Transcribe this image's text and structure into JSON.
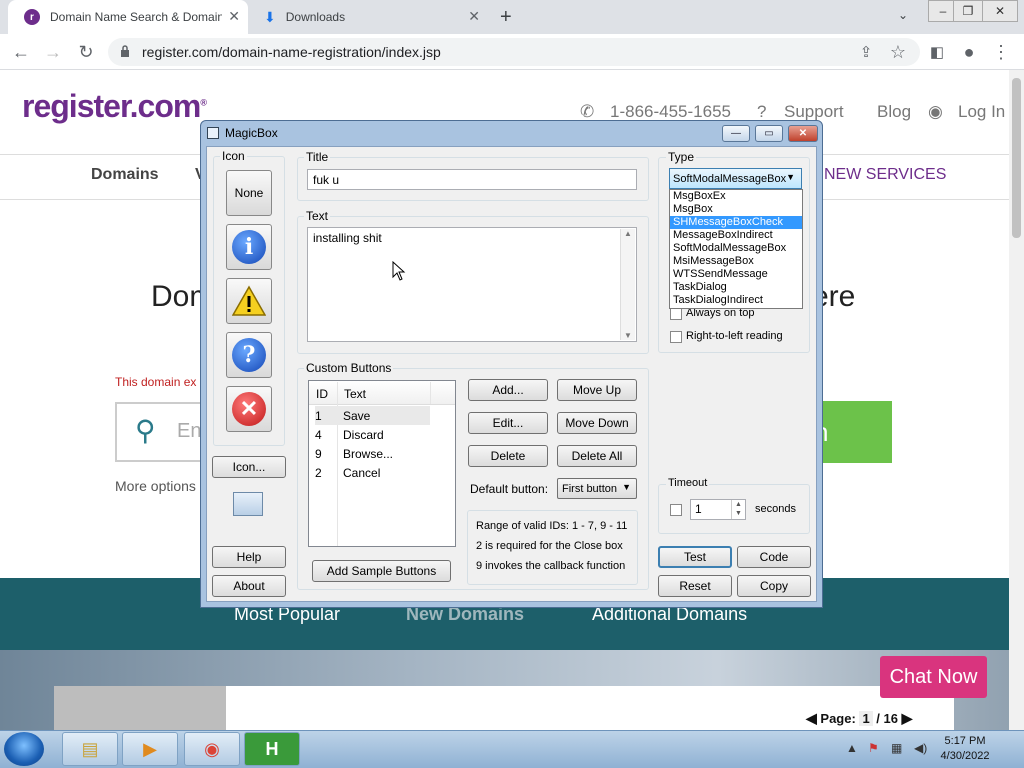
{
  "browser": {
    "tabs": [
      {
        "title": "Domain Name Search & Domain",
        "active": true
      },
      {
        "title": "Downloads",
        "active": false
      }
    ],
    "new_tab": "+",
    "url": "register.com/domain-name-registration/index.jsp"
  },
  "site": {
    "logo": "register.com",
    "logo_mark": "®",
    "phone": "1-866-455-1655",
    "support": "Support",
    "blog": "Blog",
    "login": "Log In",
    "nav": [
      "Domains",
      "V",
      "NEW SERVICES"
    ],
    "headline_left": "Dom",
    "headline_right": "ere",
    "domain_exists_text": "This domain ex",
    "search_placeholder": "Ent",
    "search_button": "h",
    "more_options": "More options",
    "teal_tabs": [
      "Most Popular",
      "New Domains",
      "Additional Domains"
    ],
    "chat_now": "Chat Now",
    "pager": {
      "label": "Page:",
      "current": "1",
      "total": "/ 16"
    }
  },
  "taskbar": {
    "time": "5:17 PM",
    "date": "4/30/2022"
  },
  "magicbox": {
    "title": "MagicBox",
    "icon_label": "Icon",
    "icon_none": "None",
    "icon_button": "Icon...",
    "help": "Help",
    "about": "About",
    "title_label": "Title",
    "title_value": "fuk u",
    "text_label": "Text",
    "text_value": "installing shit",
    "type_label": "Type",
    "type_selected": "SoftModalMessageBox",
    "type_options": [
      "MsgBoxEx",
      "MsgBox",
      "SHMessageBoxCheck",
      "MessageBoxIndirect",
      "SoftModalMessageBox",
      "MsiMessageBox",
      "WTSSendMessage",
      "TaskDialog",
      "TaskDialogIndirect"
    ],
    "type_highlight_index": 2,
    "always_on_top": "Always on top",
    "rtl": "Right-to-left reading",
    "custom_buttons_label": "Custom Buttons",
    "lv_headers": [
      "ID",
      "Text"
    ],
    "lv_rows": [
      {
        "id": "1",
        "text": "Save"
      },
      {
        "id": "4",
        "text": "Discard"
      },
      {
        "id": "9",
        "text": "Browse..."
      },
      {
        "id": "2",
        "text": "Cancel"
      }
    ],
    "add": "Add...",
    "move_up": "Move Up",
    "edit": "Edit...",
    "move_down": "Move Down",
    "delete": "Delete",
    "delete_all": "Delete All",
    "default_button_label": "Default button:",
    "default_button_value": "First button",
    "info_lines": [
      "Range of valid IDs: 1 - 7, 9 - 11",
      "2  is required for the Close box",
      "9  invokes the callback function"
    ],
    "add_sample": "Add Sample Buttons",
    "timeout_label": "Timeout",
    "timeout_value": "1",
    "seconds": "seconds",
    "test": "Test",
    "code": "Code",
    "reset": "Reset",
    "copy": "Copy"
  }
}
